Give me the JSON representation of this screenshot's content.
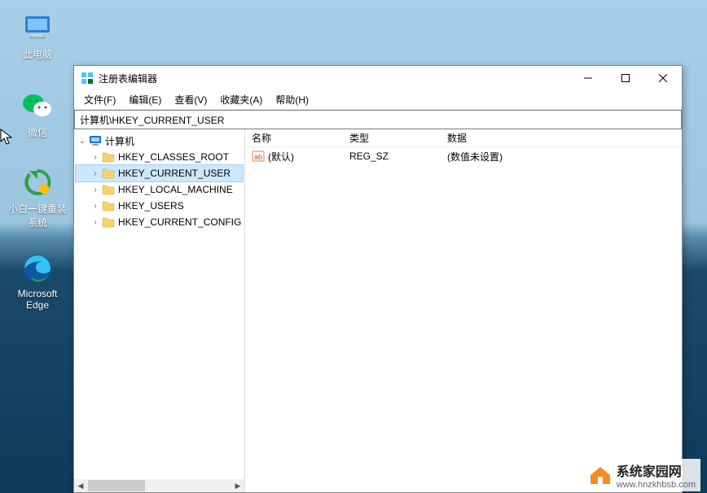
{
  "desktop": {
    "icons": [
      {
        "name": "this-pc",
        "label": "此电脑"
      },
      {
        "name": "wechat",
        "label": "微信"
      },
      {
        "name": "xiaobai-reinstall",
        "label": "小白一键重装\n系统"
      },
      {
        "name": "edge",
        "label": "Microsoft\nEdge"
      }
    ]
  },
  "window": {
    "title": "注册表编辑器",
    "menu": {
      "file": "文件(F)",
      "edit": "编辑(E)",
      "view": "查看(V)",
      "favorites": "收藏夹(A)",
      "help": "帮助(H)"
    },
    "address": "计算机\\HKEY_CURRENT_USER",
    "tree": {
      "root": "计算机",
      "keys": [
        "HKEY_CLASSES_ROOT",
        "HKEY_CURRENT_USER",
        "HKEY_LOCAL_MACHINE",
        "HKEY_USERS",
        "HKEY_CURRENT_CONFIG"
      ],
      "selected_index": 1
    },
    "list": {
      "columns": {
        "name": "名称",
        "type": "类型",
        "data": "数据"
      },
      "rows": [
        {
          "name": "(默认)",
          "type": "REG_SZ",
          "data": "(数值未设置)"
        }
      ]
    }
  },
  "brand": {
    "name": "系统家园网",
    "url": "www.hnzkhbsb.com"
  }
}
